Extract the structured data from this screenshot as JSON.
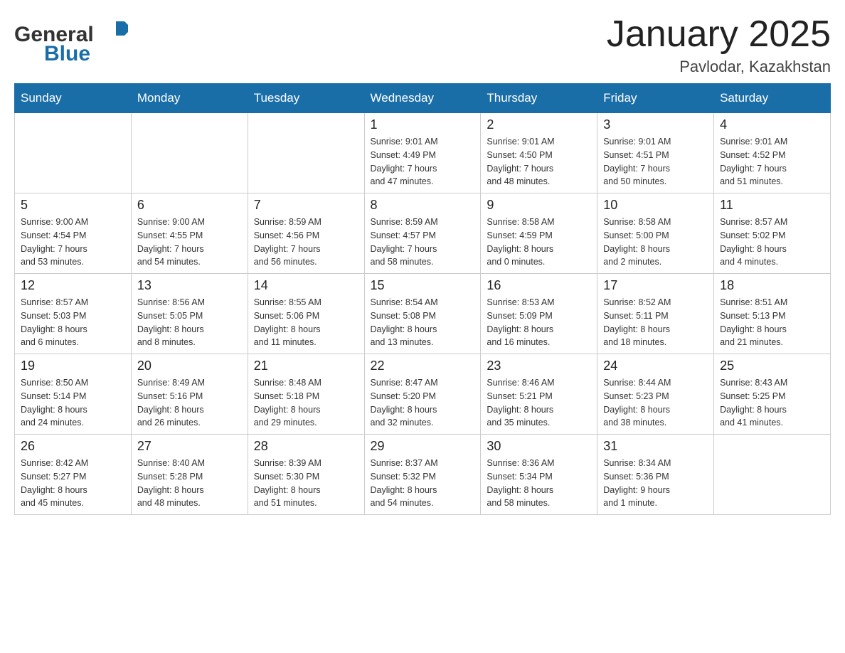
{
  "logo": {
    "general": "General",
    "blue": "Blue"
  },
  "title": {
    "month_year": "January 2025",
    "location": "Pavlodar, Kazakhstan"
  },
  "header_days": [
    "Sunday",
    "Monday",
    "Tuesday",
    "Wednesday",
    "Thursday",
    "Friday",
    "Saturday"
  ],
  "weeks": [
    [
      {
        "day": "",
        "info": ""
      },
      {
        "day": "",
        "info": ""
      },
      {
        "day": "",
        "info": ""
      },
      {
        "day": "1",
        "info": "Sunrise: 9:01 AM\nSunset: 4:49 PM\nDaylight: 7 hours\nand 47 minutes."
      },
      {
        "day": "2",
        "info": "Sunrise: 9:01 AM\nSunset: 4:50 PM\nDaylight: 7 hours\nand 48 minutes."
      },
      {
        "day": "3",
        "info": "Sunrise: 9:01 AM\nSunset: 4:51 PM\nDaylight: 7 hours\nand 50 minutes."
      },
      {
        "day": "4",
        "info": "Sunrise: 9:01 AM\nSunset: 4:52 PM\nDaylight: 7 hours\nand 51 minutes."
      }
    ],
    [
      {
        "day": "5",
        "info": "Sunrise: 9:00 AM\nSunset: 4:54 PM\nDaylight: 7 hours\nand 53 minutes."
      },
      {
        "day": "6",
        "info": "Sunrise: 9:00 AM\nSunset: 4:55 PM\nDaylight: 7 hours\nand 54 minutes."
      },
      {
        "day": "7",
        "info": "Sunrise: 8:59 AM\nSunset: 4:56 PM\nDaylight: 7 hours\nand 56 minutes."
      },
      {
        "day": "8",
        "info": "Sunrise: 8:59 AM\nSunset: 4:57 PM\nDaylight: 7 hours\nand 58 minutes."
      },
      {
        "day": "9",
        "info": "Sunrise: 8:58 AM\nSunset: 4:59 PM\nDaylight: 8 hours\nand 0 minutes."
      },
      {
        "day": "10",
        "info": "Sunrise: 8:58 AM\nSunset: 5:00 PM\nDaylight: 8 hours\nand 2 minutes."
      },
      {
        "day": "11",
        "info": "Sunrise: 8:57 AM\nSunset: 5:02 PM\nDaylight: 8 hours\nand 4 minutes."
      }
    ],
    [
      {
        "day": "12",
        "info": "Sunrise: 8:57 AM\nSunset: 5:03 PM\nDaylight: 8 hours\nand 6 minutes."
      },
      {
        "day": "13",
        "info": "Sunrise: 8:56 AM\nSunset: 5:05 PM\nDaylight: 8 hours\nand 8 minutes."
      },
      {
        "day": "14",
        "info": "Sunrise: 8:55 AM\nSunset: 5:06 PM\nDaylight: 8 hours\nand 11 minutes."
      },
      {
        "day": "15",
        "info": "Sunrise: 8:54 AM\nSunset: 5:08 PM\nDaylight: 8 hours\nand 13 minutes."
      },
      {
        "day": "16",
        "info": "Sunrise: 8:53 AM\nSunset: 5:09 PM\nDaylight: 8 hours\nand 16 minutes."
      },
      {
        "day": "17",
        "info": "Sunrise: 8:52 AM\nSunset: 5:11 PM\nDaylight: 8 hours\nand 18 minutes."
      },
      {
        "day": "18",
        "info": "Sunrise: 8:51 AM\nSunset: 5:13 PM\nDaylight: 8 hours\nand 21 minutes."
      }
    ],
    [
      {
        "day": "19",
        "info": "Sunrise: 8:50 AM\nSunset: 5:14 PM\nDaylight: 8 hours\nand 24 minutes."
      },
      {
        "day": "20",
        "info": "Sunrise: 8:49 AM\nSunset: 5:16 PM\nDaylight: 8 hours\nand 26 minutes."
      },
      {
        "day": "21",
        "info": "Sunrise: 8:48 AM\nSunset: 5:18 PM\nDaylight: 8 hours\nand 29 minutes."
      },
      {
        "day": "22",
        "info": "Sunrise: 8:47 AM\nSunset: 5:20 PM\nDaylight: 8 hours\nand 32 minutes."
      },
      {
        "day": "23",
        "info": "Sunrise: 8:46 AM\nSunset: 5:21 PM\nDaylight: 8 hours\nand 35 minutes."
      },
      {
        "day": "24",
        "info": "Sunrise: 8:44 AM\nSunset: 5:23 PM\nDaylight: 8 hours\nand 38 minutes."
      },
      {
        "day": "25",
        "info": "Sunrise: 8:43 AM\nSunset: 5:25 PM\nDaylight: 8 hours\nand 41 minutes."
      }
    ],
    [
      {
        "day": "26",
        "info": "Sunrise: 8:42 AM\nSunset: 5:27 PM\nDaylight: 8 hours\nand 45 minutes."
      },
      {
        "day": "27",
        "info": "Sunrise: 8:40 AM\nSunset: 5:28 PM\nDaylight: 8 hours\nand 48 minutes."
      },
      {
        "day": "28",
        "info": "Sunrise: 8:39 AM\nSunset: 5:30 PM\nDaylight: 8 hours\nand 51 minutes."
      },
      {
        "day": "29",
        "info": "Sunrise: 8:37 AM\nSunset: 5:32 PM\nDaylight: 8 hours\nand 54 minutes."
      },
      {
        "day": "30",
        "info": "Sunrise: 8:36 AM\nSunset: 5:34 PM\nDaylight: 8 hours\nand 58 minutes."
      },
      {
        "day": "31",
        "info": "Sunrise: 8:34 AM\nSunset: 5:36 PM\nDaylight: 9 hours\nand 1 minute."
      },
      {
        "day": "",
        "info": ""
      }
    ]
  ]
}
